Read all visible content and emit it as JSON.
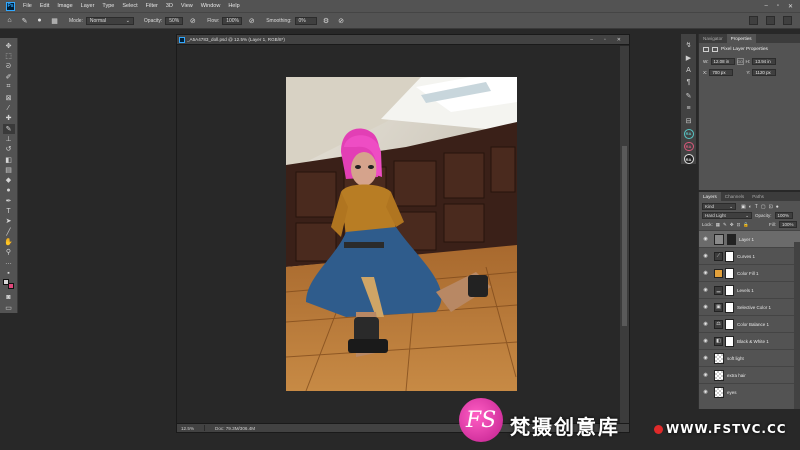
{
  "menubar": {
    "app_icon": "Ps",
    "items": [
      "File",
      "Edit",
      "Image",
      "Layer",
      "Type",
      "Select",
      "Filter",
      "3D",
      "View",
      "Window",
      "Help"
    ]
  },
  "options": {
    "mode_label": "Mode:",
    "mode_value": "Normal",
    "opacity_label": "Opacity:",
    "opacity_value": "50%",
    "flow_label": "Flow:",
    "flow_value": "100%",
    "smoothing_label": "Smoothing:",
    "smoothing_value": "0%"
  },
  "document": {
    "tab_title": "_A5A4783_doll.psd @ 12.5% (Layer 1, RGB/8*)",
    "zoom": "12.5%",
    "doc_info": "Doc: 79.3M/306.4M"
  },
  "properties": {
    "tabs": [
      "Navigator",
      "Properties"
    ],
    "header": "Pixel Layer Properties",
    "w_label": "W:",
    "w_value": "12.08 in",
    "go_label": "GO",
    "h_label": "H:",
    "h_value": "13.94 in",
    "x_label": "X:",
    "x_value": "700 px",
    "y_label": "Y:",
    "y_value": "1120 px"
  },
  "dock": {
    "badges": [
      "RA",
      "RA",
      "RA"
    ]
  },
  "layers": {
    "tabs": [
      "Layers",
      "Channels",
      "Paths"
    ],
    "kind_value": "Kind",
    "blend_value": "Hard Light",
    "opacity_label": "Opacity:",
    "opacity_value": "100%",
    "lock_label": "Lock:",
    "fill_label": "Fill:",
    "fill_value": "100%",
    "rows": [
      {
        "name": "Layer 1"
      },
      {
        "name": "Curves 1"
      },
      {
        "name": "Color Fill 1"
      },
      {
        "name": "Levels 1"
      },
      {
        "name": "Selective Color 1"
      },
      {
        "name": "Color Balance 1"
      },
      {
        "name": "Black & White 1"
      },
      {
        "name": "soft light"
      },
      {
        "name": "extra hair"
      },
      {
        "name": "eyes"
      }
    ]
  },
  "watermark": {
    "logo": "FS",
    "text": "梵摄创意库",
    "url": "WWW.FSTVC.CC"
  },
  "colors": {
    "accent": "#31a8ff",
    "color_fill_swatch": "#e3a13b",
    "bg_swatch": "#e0477a"
  }
}
